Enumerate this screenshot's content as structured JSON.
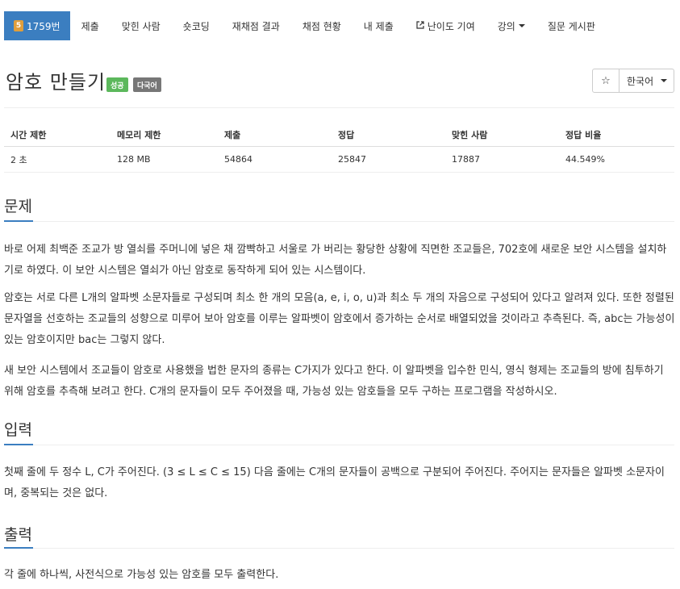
{
  "nav": {
    "problem_tab": {
      "tier": "5",
      "label": "1759번"
    },
    "items": [
      "제출",
      "맞힌 사람",
      "숏코딩",
      "재채점 결과",
      "채점 현황",
      "내 제출",
      "난이도 기여",
      "강의",
      "질문 게시판"
    ]
  },
  "problem": {
    "title": "암호 만들기",
    "labels": {
      "status": "성공",
      "multilang": "다국어"
    },
    "language_select": "한국어",
    "star_icon": "☆"
  },
  "info": {
    "headers": [
      "시간 제한",
      "메모리 제한",
      "제출",
      "정답",
      "맞힌 사람",
      "정답 비율"
    ],
    "values": [
      "2 초",
      "128 MB",
      "54864",
      "25847",
      "17887",
      "44.549%"
    ]
  },
  "sections": {
    "description": {
      "title": "문제",
      "paragraphs": [
        "바로 어제 최백준 조교가 방 열쇠를 주머니에 넣은 채 깜빡하고 서울로 가 버리는 황당한 상황에 직면한 조교들은, 702호에 새로운 보안 시스템을 설치하기로 하였다. 이 보안 시스템은 열쇠가 아닌 암호로 동작하게 되어 있는 시스템이다.",
        "암호는 서로 다른 L개의 알파벳 소문자들로 구성되며 최소 한 개의 모음(a, e, i, o, u)과 최소 두 개의 자음으로 구성되어 있다고 알려져 있다. 또한 정렬된 문자열을 선호하는 조교들의 성향으로 미루어 보아 암호를 이루는 알파벳이 암호에서 증가하는 순서로 배열되었을 것이라고 추측된다. 즉, abc는 가능성이 있는 암호이지만 bac는 그렇지 않다.",
        "새 보안 시스템에서 조교들이 암호로 사용했을 법한 문자의 종류는 C가지가 있다고 한다. 이 알파벳을 입수한 민식, 영식 형제는 조교들의 방에 침투하기 위해 암호를 추측해 보려고 한다. C개의 문자들이 모두 주어졌을 때, 가능성 있는 암호들을 모두 구하는 프로그램을 작성하시오."
      ]
    },
    "input": {
      "title": "입력",
      "text": "첫째 줄에 두 정수 L, C가 주어진다. (3 ≤ L ≤ C ≤ 15) 다음 줄에는 C개의 문자들이 공백으로 구분되어 주어진다. 주어지는 문자들은 알파벳 소문자이며, 중복되는 것은 없다."
    },
    "output": {
      "title": "출력",
      "text": "각 줄에 하나씩, 사전식으로 가능성 있는 암호를 모두 출력한다."
    }
  },
  "colors": {
    "primary": "#3b7ec0",
    "success": "#5cb85c",
    "gray_label": "#777777",
    "tier": "#e09e3b"
  }
}
